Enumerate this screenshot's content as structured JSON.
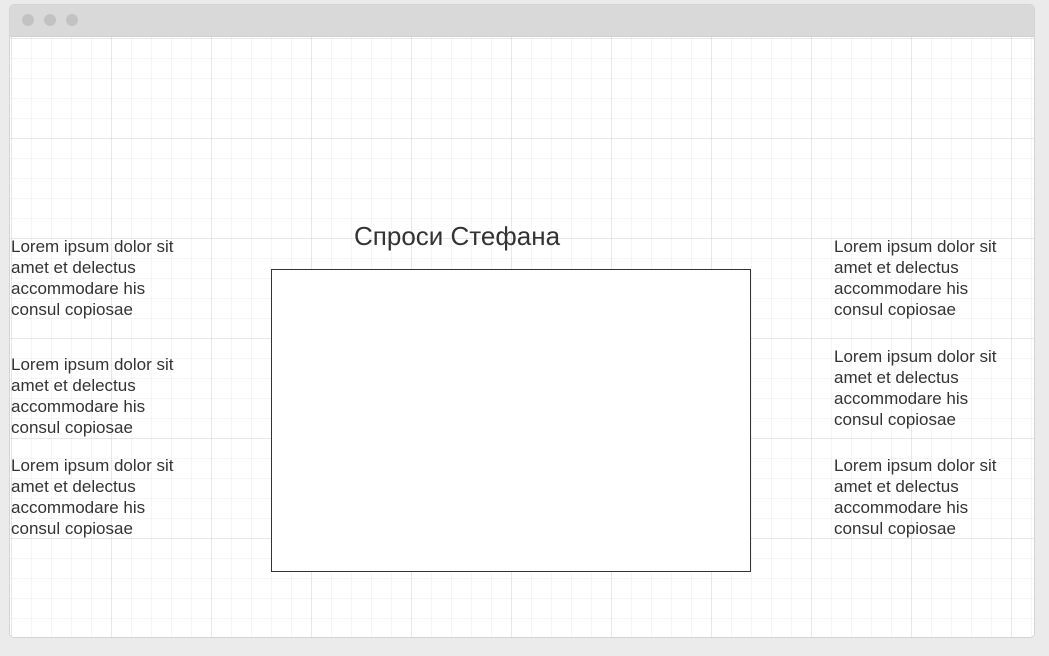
{
  "window": {
    "title_dots": [
      "close",
      "minimize",
      "maximize"
    ]
  },
  "page": {
    "title": "Спроси Стефана"
  },
  "left_column": [
    {
      "text": "Lorem ipsum dolor sit amet et delectus accommodare his consul copiosae"
    },
    {
      "text": "Lorem ipsum dolor sit amet et delectus accommodare his consul copiosae"
    },
    {
      "text": "Lorem ipsum dolor sit amet et delectus accommodare his consul copiosae"
    }
  ],
  "right_column": [
    {
      "text": "Lorem ipsum dolor sit amet et delectus accommodare his consul copiosae"
    },
    {
      "text": "Lorem ipsum dolor sit amet et delectus accommodare his consul copiosae"
    },
    {
      "text": "Lorem ipsum dolor sit amet et delectus accommodare his consul copiosae"
    }
  ],
  "colors": {
    "text": "#333333",
    "titlebar": "#d9d9d9",
    "background": "#ebebeb",
    "box_border": "#333333"
  }
}
